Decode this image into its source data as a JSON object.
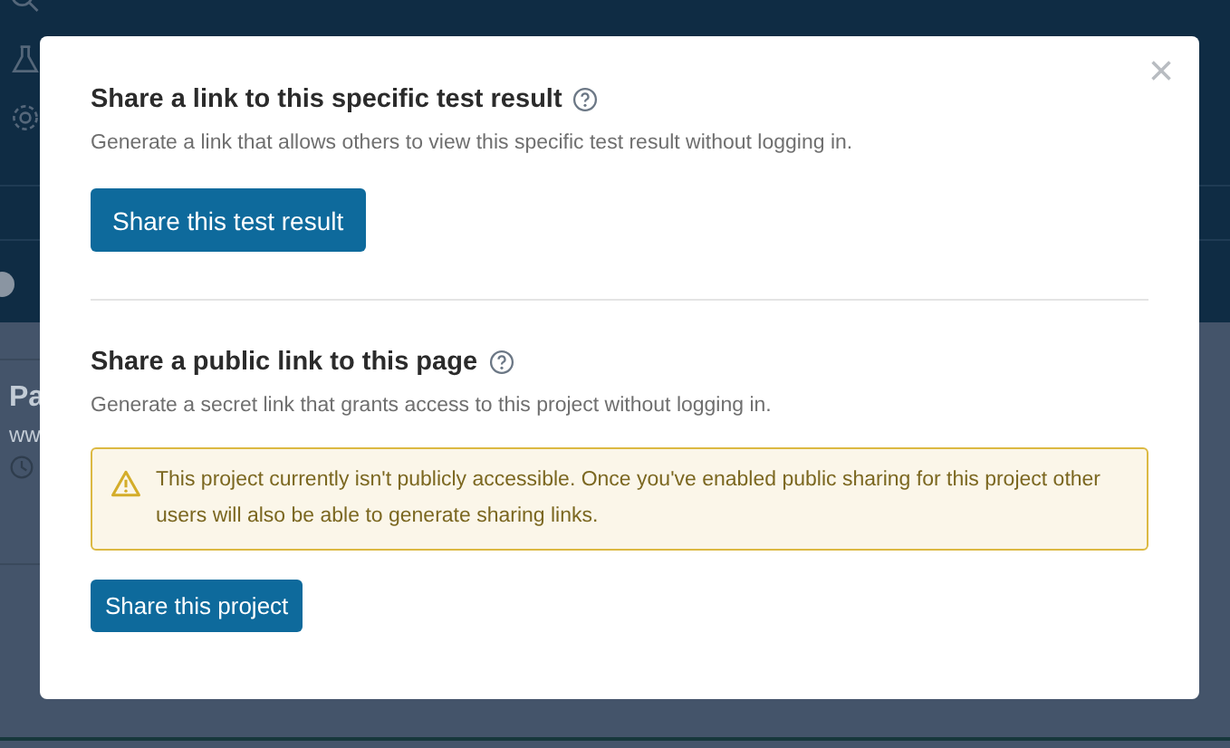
{
  "background": {
    "card_title": "Pa",
    "card_subtitle": "ww"
  },
  "dialog": {
    "close": "×",
    "sections": [
      {
        "title": "Share a link to this specific test result",
        "description": "Generate a link that allows others to view this specific test result without logging in.",
        "button": "Share this test result",
        "kind": "large"
      },
      {
        "title": "Share a public link to this page",
        "description": "Generate a secret link that grants access to this project without logging in.",
        "warning": "This project currently isn't publicly accessible. Once you've enabled public sharing for this project other users will also be able to generate sharing links.",
        "button": "Share this project",
        "kind": "small"
      }
    ]
  }
}
